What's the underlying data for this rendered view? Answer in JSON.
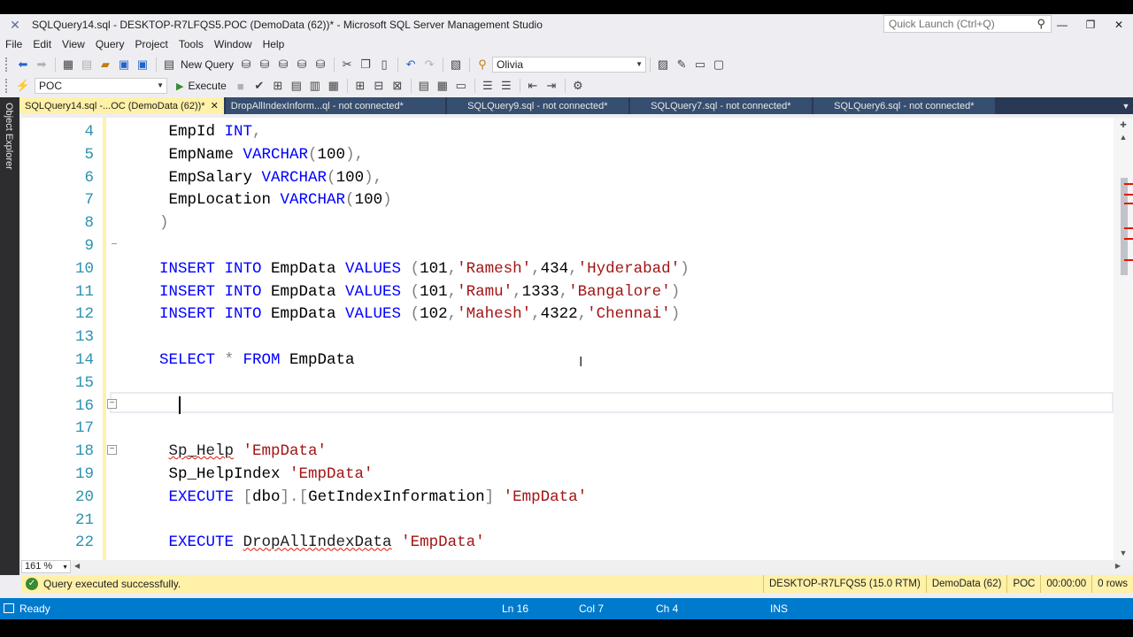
{
  "window": {
    "title": "SQLQuery14.sql - DESKTOP-R7LFQS5.POC (DemoData (62))* - Microsoft SQL Server Management Studio",
    "quick_launch_placeholder": "Quick Launch (Ctrl+Q)"
  },
  "menu": [
    "File",
    "Edit",
    "View",
    "Query",
    "Project",
    "Tools",
    "Window",
    "Help"
  ],
  "toolbar1": {
    "new_query_label": "New Query",
    "profile_value": "Olivia"
  },
  "toolbar2": {
    "database_value": "POC",
    "execute_label": "Execute"
  },
  "side_panel": {
    "label": "Object Explorer"
  },
  "tabs": [
    {
      "label": "SQLQuery14.sql -...OC (DemoData (62))*",
      "active": true
    },
    {
      "label": "DropAllIndexInform...ql - not connected*",
      "active": false
    },
    {
      "label": "SQLQuery9.sql - not connected*",
      "active": false
    },
    {
      "label": "SQLQuery7.sql - not connected*",
      "active": false
    },
    {
      "label": "SQLQuery6.sql - not connected*",
      "active": false
    }
  ],
  "editor": {
    "lines": [
      {
        "n": "4",
        "tokens": [
          [
            "id",
            " EmpId "
          ],
          [
            "kw",
            "INT"
          ],
          [
            "op",
            ","
          ]
        ]
      },
      {
        "n": "5",
        "tokens": [
          [
            "id",
            " EmpName "
          ],
          [
            "kw",
            "VARCHAR"
          ],
          [
            "op",
            "("
          ],
          [
            "id",
            "100"
          ],
          [
            "op",
            "),"
          ]
        ]
      },
      {
        "n": "6",
        "tokens": [
          [
            "id",
            " EmpSalary "
          ],
          [
            "kw",
            "VARCHAR"
          ],
          [
            "op",
            "("
          ],
          [
            "id",
            "100"
          ],
          [
            "op",
            "),"
          ]
        ]
      },
      {
        "n": "7",
        "tokens": [
          [
            "id",
            " EmpLocation "
          ],
          [
            "kw",
            "VARCHAR"
          ],
          [
            "op",
            "("
          ],
          [
            "id",
            "100"
          ],
          [
            "op",
            ")"
          ]
        ]
      },
      {
        "n": "8",
        "tokens": [
          [
            "op",
            ")"
          ]
        ]
      },
      {
        "n": "9",
        "tokens": []
      },
      {
        "n": "10",
        "tokens": [
          [
            "kw",
            "INSERT INTO "
          ],
          [
            "id",
            "EmpData "
          ],
          [
            "kw",
            "VALUES "
          ],
          [
            "op",
            "("
          ],
          [
            "id",
            "101"
          ],
          [
            "op",
            ","
          ],
          [
            "str",
            "'Ramesh'"
          ],
          [
            "op",
            ","
          ],
          [
            "id",
            "434"
          ],
          [
            "op",
            ","
          ],
          [
            "str",
            "'Hyderabad'"
          ],
          [
            "op",
            ")"
          ]
        ]
      },
      {
        "n": "11",
        "tokens": [
          [
            "kw",
            "INSERT INTO "
          ],
          [
            "id",
            "EmpData "
          ],
          [
            "kw",
            "VALUES "
          ],
          [
            "op",
            "("
          ],
          [
            "id",
            "101"
          ],
          [
            "op",
            ","
          ],
          [
            "str",
            "'Ramu'"
          ],
          [
            "op",
            ","
          ],
          [
            "id",
            "1333"
          ],
          [
            "op",
            ","
          ],
          [
            "str",
            "'Bangalore'"
          ],
          [
            "op",
            ")"
          ]
        ]
      },
      {
        "n": "12",
        "tokens": [
          [
            "kw",
            "INSERT INTO "
          ],
          [
            "id",
            "EmpData "
          ],
          [
            "kw",
            "VALUES "
          ],
          [
            "op",
            "("
          ],
          [
            "id",
            "102"
          ],
          [
            "op",
            ","
          ],
          [
            "str",
            "'Mahesh'"
          ],
          [
            "op",
            ","
          ],
          [
            "id",
            "4322"
          ],
          [
            "op",
            ","
          ],
          [
            "str",
            "'Chennai'"
          ],
          [
            "op",
            ")"
          ]
        ]
      },
      {
        "n": "13",
        "tokens": []
      },
      {
        "n": "14",
        "tokens": [
          [
            "kw",
            "SELECT "
          ],
          [
            "op",
            "* "
          ],
          [
            "kw",
            "FROM "
          ],
          [
            "id",
            "EmpData"
          ]
        ]
      },
      {
        "n": "15",
        "tokens": []
      },
      {
        "n": "16",
        "tokens": []
      },
      {
        "n": "17",
        "tokens": []
      },
      {
        "n": "18",
        "tokens": [
          [
            "id",
            " "
          ],
          [
            "squig",
            "Sp_Help"
          ],
          [
            "id",
            " "
          ],
          [
            "str",
            "'EmpData'"
          ]
        ]
      },
      {
        "n": "19",
        "tokens": [
          [
            "id",
            " Sp_HelpIndex "
          ],
          [
            "str",
            "'EmpData'"
          ]
        ]
      },
      {
        "n": "20",
        "tokens": [
          [
            "kw",
            " EXECUTE "
          ],
          [
            "op",
            "["
          ],
          [
            "id",
            "dbo"
          ],
          [
            "op",
            "]."
          ],
          [
            "op",
            "["
          ],
          [
            "id",
            "GetIndexInformation"
          ],
          [
            "op",
            "] "
          ],
          [
            "str",
            "'EmpData'"
          ]
        ]
      },
      {
        "n": "21",
        "tokens": []
      },
      {
        "n": "22",
        "tokens": [
          [
            "kw",
            " EXECUTE "
          ],
          [
            "squig",
            "DropAllIndexData"
          ],
          [
            "id",
            " "
          ],
          [
            "str",
            "'EmpData'"
          ]
        ]
      }
    ],
    "zoom": "161 %"
  },
  "query_status": {
    "message": "Query executed successfully.",
    "server": "DESKTOP-R7LFQS5 (15.0 RTM)",
    "database": "DemoData (62)",
    "db": "POC",
    "time": "00:00:00",
    "rows": "0 rows"
  },
  "status_bar": {
    "state": "Ready",
    "line": "Ln 16",
    "col": "Col 7",
    "ch": "Ch 4",
    "mode": "INS"
  },
  "colors": {
    "accent": "#007acc",
    "tab_active": "#fff1a8",
    "tab_strip": "#293955",
    "keyword": "#0000ff",
    "string": "#a31515"
  }
}
